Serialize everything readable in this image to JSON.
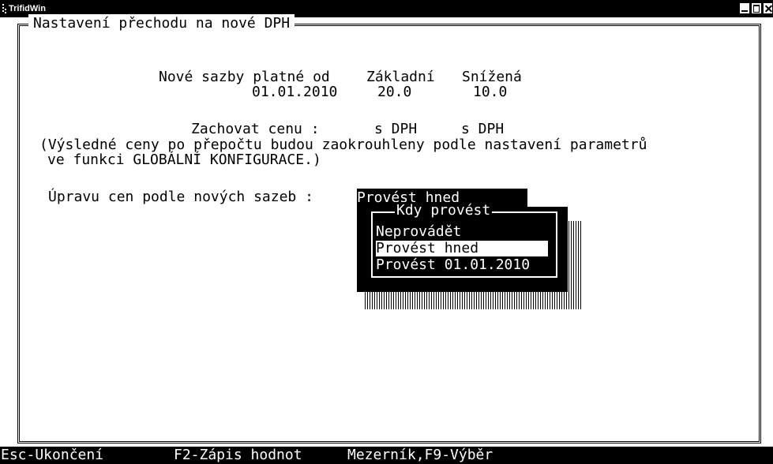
{
  "window": {
    "title": "TrifidWin"
  },
  "panel": {
    "title": "Nastavení přechodu na nové DPH",
    "rates_label": "Nové sazby platné od",
    "effective_date": "01.01.2010",
    "basic_label": "Základní",
    "basic_value": "20.0",
    "reduced_label": "Snížená",
    "reduced_value": "10.0",
    "keep_price_label": "Zachovat cenu :",
    "keep_price_basic": "s DPH",
    "keep_price_reduced": "s DPH",
    "note_line1": "(Výsledné ceny po přepočtu budou zaokrouhleny podle nastavení parametrů",
    "note_line2": "ve funkci GLOBÁLNÍ KONFIGURACE.)",
    "update_label": "Úpravu cen podle nových sazeb :",
    "update_value": "Provést hned"
  },
  "popup": {
    "title": "Kdy provést",
    "options": [
      "Neprovádět",
      "Provést hned",
      "Provést 01.01.2010"
    ],
    "selected_index": 1
  },
  "statusbar": {
    "esc": "Esc-Ukončení",
    "f2": "F2-Zápis hodnot",
    "space_f9": "Mezerník,F9-Výběr"
  },
  "colors": {
    "background": "#ffffff",
    "foreground": "#000000",
    "inverse_background": "#000000",
    "inverse_foreground": "#ffffff"
  },
  "icons": {
    "app": "dotted-app-icon",
    "minimize": "minimize-icon",
    "maximize": "maximize-icon",
    "close": "close-icon"
  }
}
